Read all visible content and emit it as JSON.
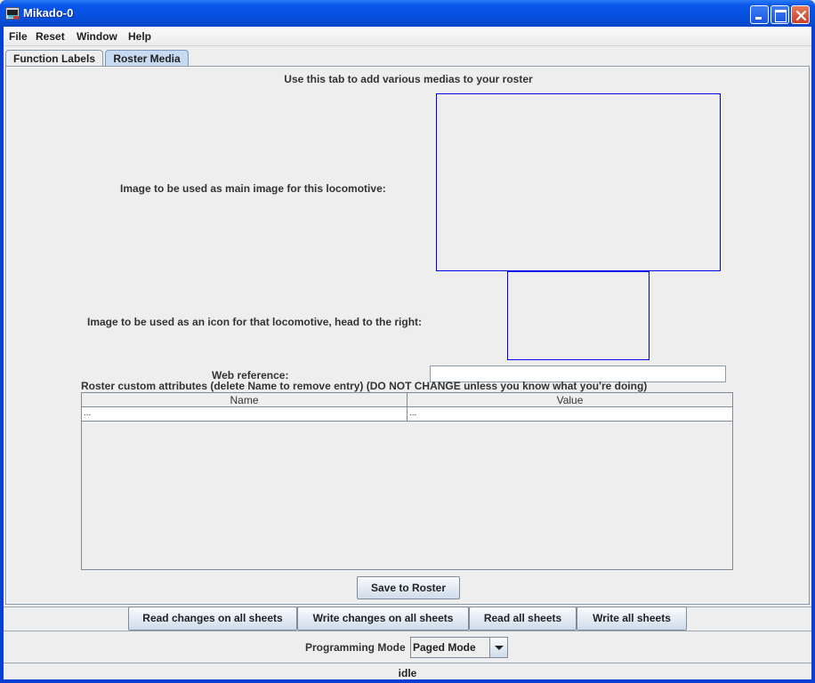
{
  "window": {
    "title": "Mikado-0",
    "controls": {
      "minimize": "minimize",
      "maximize": "maximize",
      "close": "close"
    }
  },
  "menubar": {
    "items": [
      {
        "label": "File"
      },
      {
        "label": "Reset"
      },
      {
        "label": "Window"
      },
      {
        "label": "Help"
      }
    ]
  },
  "tabs": [
    {
      "label": "Function Labels",
      "selected": false
    },
    {
      "label": "Roster Media",
      "selected": true
    }
  ],
  "roster_media": {
    "heading": "Use this tab to add various medias to your roster",
    "main_image_label": "Image to be used as main image for this locomotive:",
    "icon_image_label": "Image to be used as an icon for that locomotive, head to the right:",
    "web_reference_label": "Web reference:",
    "web_reference_value": "",
    "attributes_label": "Roster custom attributes (delete Name to remove entry) (DO NOT CHANGE unless you know what you're doing)",
    "table": {
      "columns": [
        "Name",
        "Value"
      ],
      "rows": [
        {
          "name": "...",
          "value": "..."
        }
      ]
    },
    "save_button": "Save to Roster"
  },
  "actions": {
    "read_changes": "Read changes on all sheets",
    "write_changes": "Write changes on all sheets",
    "read_all": "Read all sheets",
    "write_all": "Write all sheets"
  },
  "programming": {
    "label": "Programming Mode",
    "selected_mode": "Paged Mode"
  },
  "status": "idle",
  "colors": {
    "image_box_border": "#0000ee",
    "selected_tab": "#c8daf0",
    "title_bar": "#0550e0"
  }
}
